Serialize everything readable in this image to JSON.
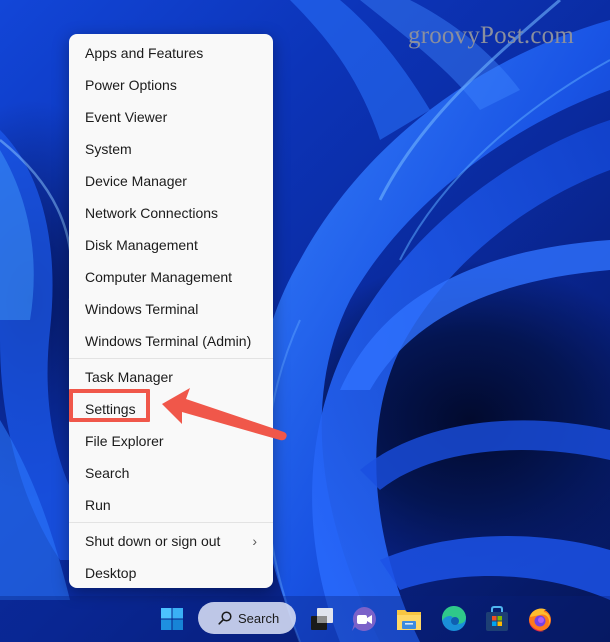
{
  "watermark": "groovyPost.com",
  "context_menu": {
    "groups": [
      [
        {
          "label": "Apps and Features"
        },
        {
          "label": "Power Options"
        },
        {
          "label": "Event Viewer"
        },
        {
          "label": "System"
        },
        {
          "label": "Device Manager"
        },
        {
          "label": "Network Connections"
        },
        {
          "label": "Disk Management"
        },
        {
          "label": "Computer Management"
        },
        {
          "label": "Windows Terminal"
        },
        {
          "label": "Windows Terminal (Admin)"
        }
      ],
      [
        {
          "label": "Task Manager"
        },
        {
          "label": "Settings",
          "highlighted": true
        },
        {
          "label": "File Explorer"
        },
        {
          "label": "Search"
        },
        {
          "label": "Run"
        }
      ],
      [
        {
          "label": "Shut down or sign out",
          "submenu": true,
          "chevron": "›"
        },
        {
          "label": "Desktop"
        }
      ]
    ]
  },
  "annotation": {
    "color": "#f0574a",
    "target": "Settings"
  },
  "taskbar": {
    "start_icon": "windows-start-icon",
    "search_label": "Search",
    "apps": [
      {
        "name": "task-view-icon"
      },
      {
        "name": "teams-chat-icon"
      },
      {
        "name": "file-explorer-icon"
      },
      {
        "name": "edge-icon"
      },
      {
        "name": "microsoft-store-icon"
      },
      {
        "name": "firefox-icon"
      }
    ]
  }
}
